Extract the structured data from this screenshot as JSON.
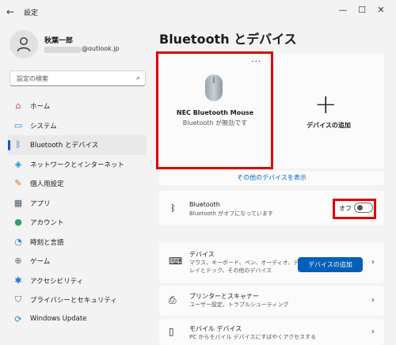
{
  "window": {
    "title": "設定",
    "back_glyph": "←",
    "minimize_glyph": "—",
    "maximize_glyph": "☐",
    "close_glyph": "✕"
  },
  "profile": {
    "name": "秋葉一郎",
    "email_visible": "@outlook.jp"
  },
  "search": {
    "placeholder": "設定の検索",
    "icon_glyph": "⌕"
  },
  "sidebar": {
    "items": [
      {
        "label": "ホーム",
        "icon": "home-icon",
        "glyph": "⌂",
        "color": "#c0504d"
      },
      {
        "label": "システム",
        "icon": "system-icon",
        "glyph": "▭",
        "color": "#1f8fd8"
      },
      {
        "label": "Bluetooth とデバイス",
        "icon": "bluetooth-icon",
        "glyph": "ᛒ",
        "color": "#0067c0",
        "active": true
      },
      {
        "label": "ネットワークとインターネット",
        "icon": "network-icon",
        "glyph": "◈",
        "color": "#1f8fd8"
      },
      {
        "label": "個人用設定",
        "icon": "brush-icon",
        "glyph": "✎",
        "color": "#d86f1f"
      },
      {
        "label": "アプリ",
        "icon": "apps-icon",
        "glyph": "▦",
        "color": "#4a5a6a"
      },
      {
        "label": "アカウント",
        "icon": "account-icon",
        "glyph": "●",
        "color": "#2fa06a"
      },
      {
        "label": "時刻と言語",
        "icon": "time-language-icon",
        "glyph": "◔",
        "color": "#1f8fd8"
      },
      {
        "label": "ゲーム",
        "icon": "game-icon",
        "glyph": "⊕",
        "color": "#6a6a6a"
      },
      {
        "label": "アクセシビリティ",
        "icon": "accessibility-icon",
        "glyph": "✱",
        "color": "#1f6fd8"
      },
      {
        "label": "プライバシーとセキュリティ",
        "icon": "shield-icon",
        "glyph": "⛉",
        "color": "#5a6a7a"
      },
      {
        "label": "Windows Update",
        "icon": "update-icon",
        "glyph": "⟳",
        "color": "#1f8fd8"
      }
    ]
  },
  "main": {
    "title": "Bluetooth とデバイス",
    "device_card": {
      "name": "NEC Bluetooth Mouse",
      "status": "Bluetooth が無効です",
      "more_glyph": "···",
      "icon": "mouse-icon"
    },
    "add_card": {
      "label": "デバイスの追加",
      "glyph": "+"
    },
    "more_devices_link": "その他のデバイスを表示",
    "bluetooth_row": {
      "title": "Bluetooth",
      "subtitle": "Bluetooth がオフになっています",
      "toggle_label": "オフ",
      "toggle_on": false,
      "icon_glyph": "ᛒ"
    },
    "devices_row": {
      "title": "デバイス",
      "subtitle_line1": "マウス、キーボード、ペン、オーディオ、ディスプ",
      "subtitle_line2": "レイとドック、その他のデバイス",
      "button": "デバイスの追加",
      "icon_glyph": "⌨"
    },
    "printers_row": {
      "title": "プリンターとスキャナー",
      "subtitle": "ユーザー設定、トラブルシューティング",
      "icon_glyph": "⎙"
    },
    "mobile_row": {
      "title": "モバイル デバイス",
      "subtitle": "PC からモバイル デバイスにすばやくアクセスする",
      "icon_glyph": "▯"
    },
    "chevron_glyph": "›"
  },
  "colors": {
    "accent": "#005fb8",
    "highlight": "#e00000",
    "link": "#0067c0"
  }
}
